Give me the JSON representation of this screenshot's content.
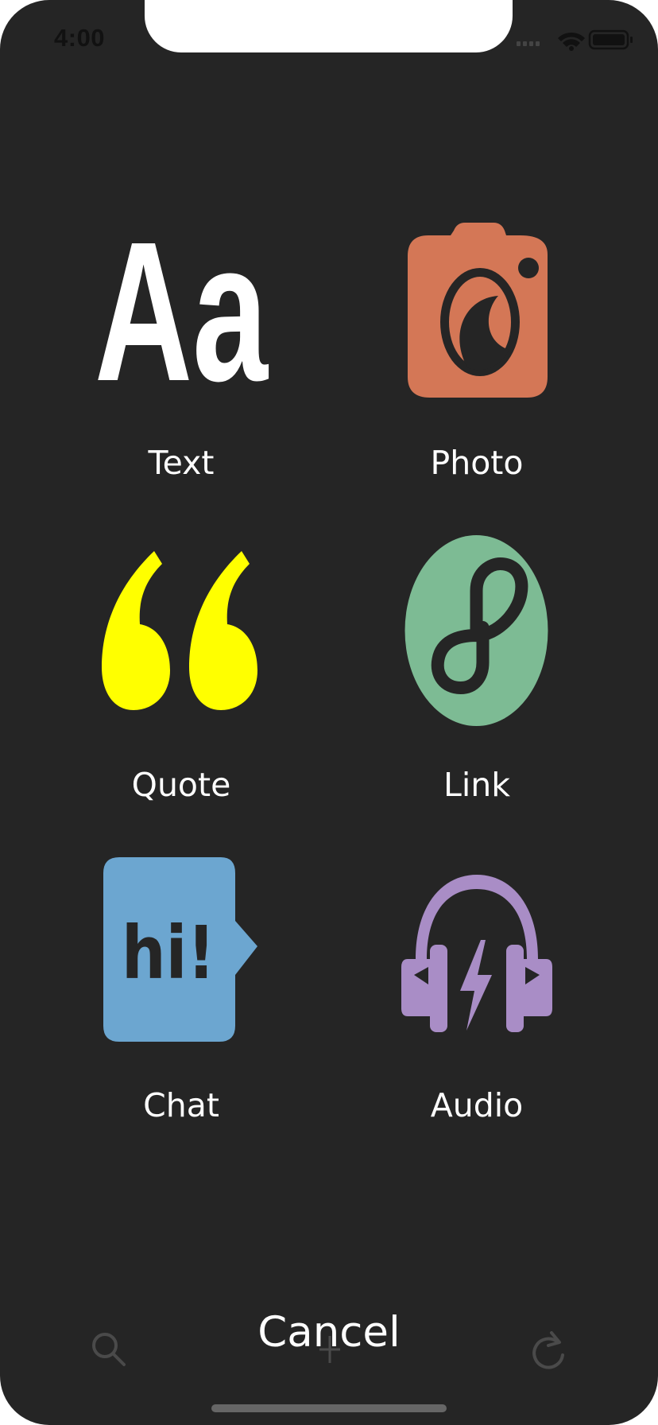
{
  "status_bar": {
    "time": "4:00"
  },
  "post_types": [
    {
      "label": "Text",
      "icon": "text-aa-icon",
      "color": "#ffffff"
    },
    {
      "label": "Photo",
      "icon": "camera-icon",
      "color": "#d47756"
    },
    {
      "label": "Quote",
      "icon": "quote-marks-icon",
      "color": "#ffff00"
    },
    {
      "label": "Link",
      "icon": "link-icon",
      "color": "#7dbb94"
    },
    {
      "label": "Chat",
      "icon": "chat-bubble-icon",
      "color": "#6ca6d0"
    },
    {
      "label": "Audio",
      "icon": "headphones-icon",
      "color": "#a98dc6"
    }
  ],
  "chat_icon_text": "hi!",
  "text_icon_text": "Aa",
  "cancel_label": "Cancel",
  "tab_bar": {
    "icons": [
      "search-icon",
      "plus-icon",
      "refresh-icon"
    ]
  },
  "colors": {
    "background": "#252525",
    "text": "#ffffff",
    "dim_icon": "#4a4a4a"
  }
}
